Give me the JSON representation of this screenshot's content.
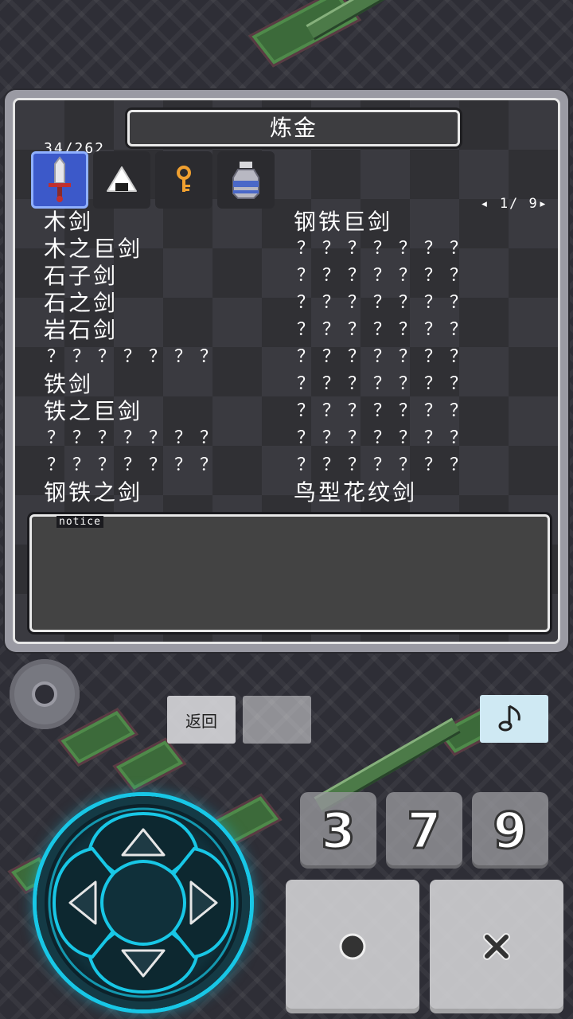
{
  "window": {
    "title": "炼金",
    "item_count": "34/262",
    "page_indicator": "◂ 1/ 9▸",
    "notice_label": "notice",
    "notice_text": ""
  },
  "categories": [
    {
      "name": "weapon",
      "icon": "sword-icon",
      "active": true
    },
    {
      "name": "food",
      "icon": "onigiri-icon",
      "active": false
    },
    {
      "name": "key",
      "icon": "key-icon",
      "active": false
    },
    {
      "name": "jar",
      "icon": "jar-icon",
      "active": false
    }
  ],
  "recipes_left": [
    "木剑",
    "木之巨剑",
    "石子剑",
    "石之剑",
    "岩石剑",
    "？？？？？？？",
    "铁剑",
    "铁之巨剑",
    "？？？？？？？",
    "？？？？？？？",
    "钢铁之剑"
  ],
  "recipes_right": [
    "钢铁巨剑",
    "？？？？？？？",
    "？？？？？？？",
    "？？？？？？？",
    "？？？？？？？",
    "？？？？？？？",
    "？？？？？？？",
    "？？？？？？？",
    "？？？？？？？",
    "？？？？？？？",
    "鸟型花纹剑"
  ],
  "controls": {
    "back_label": "返回",
    "music_icon": "music-note-icon",
    "settings_icon": "gear-icon",
    "numbers": [
      "3",
      "7",
      "9"
    ],
    "confirm_icon": "circle-icon",
    "cancel_icon": "cross-icon",
    "dpad_color": "#18c7e6"
  }
}
